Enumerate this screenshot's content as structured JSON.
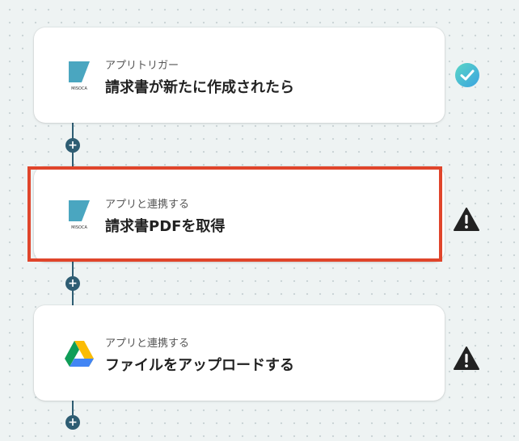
{
  "steps": [
    {
      "subtitle": "アプリトリガー",
      "title": "請求書が新たに作成されたら",
      "app_icon": "misoca-logo",
      "status": "success",
      "logo_text": "MISOCA"
    },
    {
      "subtitle": "アプリと連携する",
      "title": "請求書PDFを取得",
      "app_icon": "misoca-logo",
      "status": "warning",
      "logo_text": "MISOCA",
      "highlighted": true
    },
    {
      "subtitle": "アプリと連携する",
      "title": "ファイルをアップロードする",
      "app_icon": "google-drive-logo",
      "status": "warning"
    }
  ],
  "add_button_label": "+",
  "colors": {
    "accent": "#2e5d73",
    "highlight": "#e0452b",
    "success": "#4fc3d6",
    "warning": "#222222"
  }
}
